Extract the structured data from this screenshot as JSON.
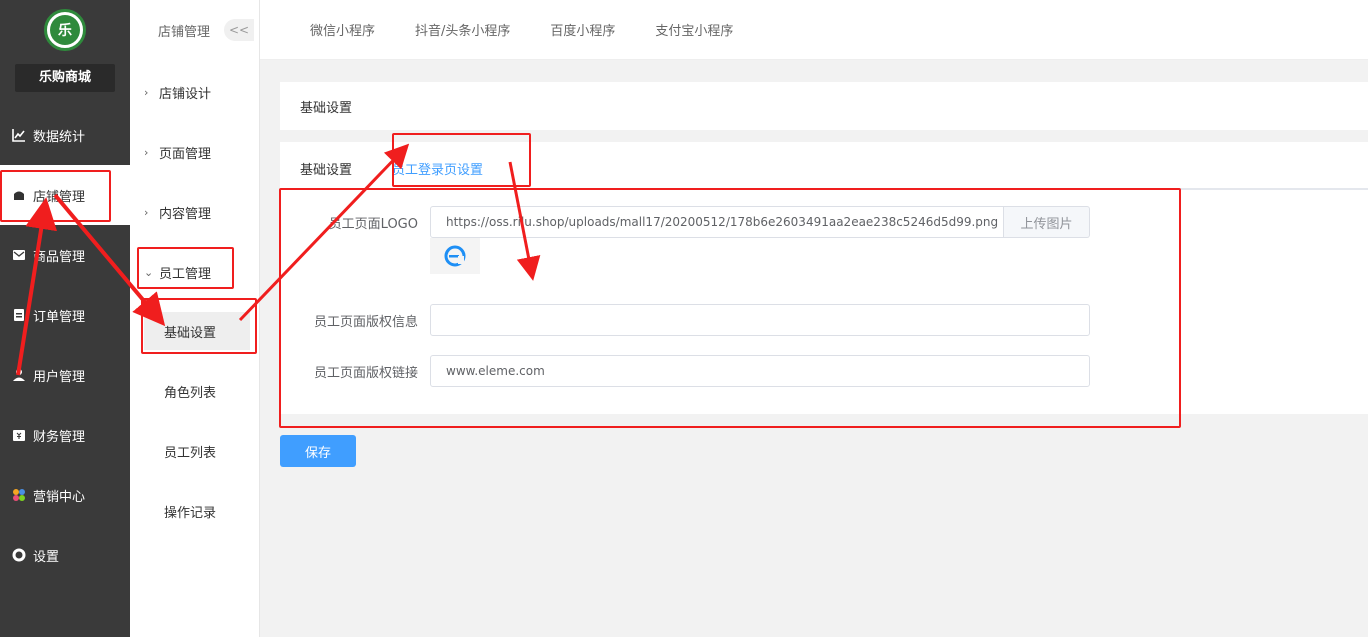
{
  "app": {
    "shop_name": "乐购商城",
    "logo_text": "乐"
  },
  "sidebar": {
    "items": [
      {
        "label": "数据统计",
        "icon": "chart-line-icon"
      },
      {
        "label": "店铺管理",
        "icon": "store-icon"
      },
      {
        "label": "商品管理",
        "icon": "mail-icon"
      },
      {
        "label": "订单管理",
        "icon": "clipboard-icon"
      },
      {
        "label": "用户管理",
        "icon": "user-icon"
      },
      {
        "label": "财务管理",
        "icon": "wallet-icon"
      },
      {
        "label": "营销中心",
        "icon": "marketing-icon"
      },
      {
        "label": "设置",
        "icon": "gear-icon"
      }
    ]
  },
  "subnav": {
    "title": "店铺管理",
    "collapse_label": "<<",
    "groups": [
      {
        "label": "店铺设计"
      },
      {
        "label": "页面管理"
      },
      {
        "label": "内容管理"
      },
      {
        "label": "员工管理"
      }
    ],
    "children": [
      {
        "label": "基础设置"
      },
      {
        "label": "角色列表"
      },
      {
        "label": "员工列表"
      },
      {
        "label": "操作记录"
      }
    ]
  },
  "topbar": {
    "tabs": [
      "微信小程序",
      "抖音/头条小程序",
      "百度小程序",
      "支付宝小程序"
    ]
  },
  "main": {
    "section_title": "基础设置",
    "tabs": [
      "基础设置",
      "员工登录页设置"
    ],
    "form": {
      "logo_label": "员工页面LOGO",
      "logo_value": "https://oss.rilu.shop/uploads/mall17/20200512/178b6e2603491aa2eae238c5246d5d99.png",
      "upload_label": "上传图片",
      "copyright_label": "员工页面版权信息",
      "copyright_value": "",
      "link_label": "员工页面版权链接",
      "link_value": "www.eleme.com"
    },
    "save_label": "保存"
  },
  "colors": {
    "primary": "#409eff",
    "annotation": "#f01e1e",
    "sidebar_bg": "#3a3a3a"
  }
}
